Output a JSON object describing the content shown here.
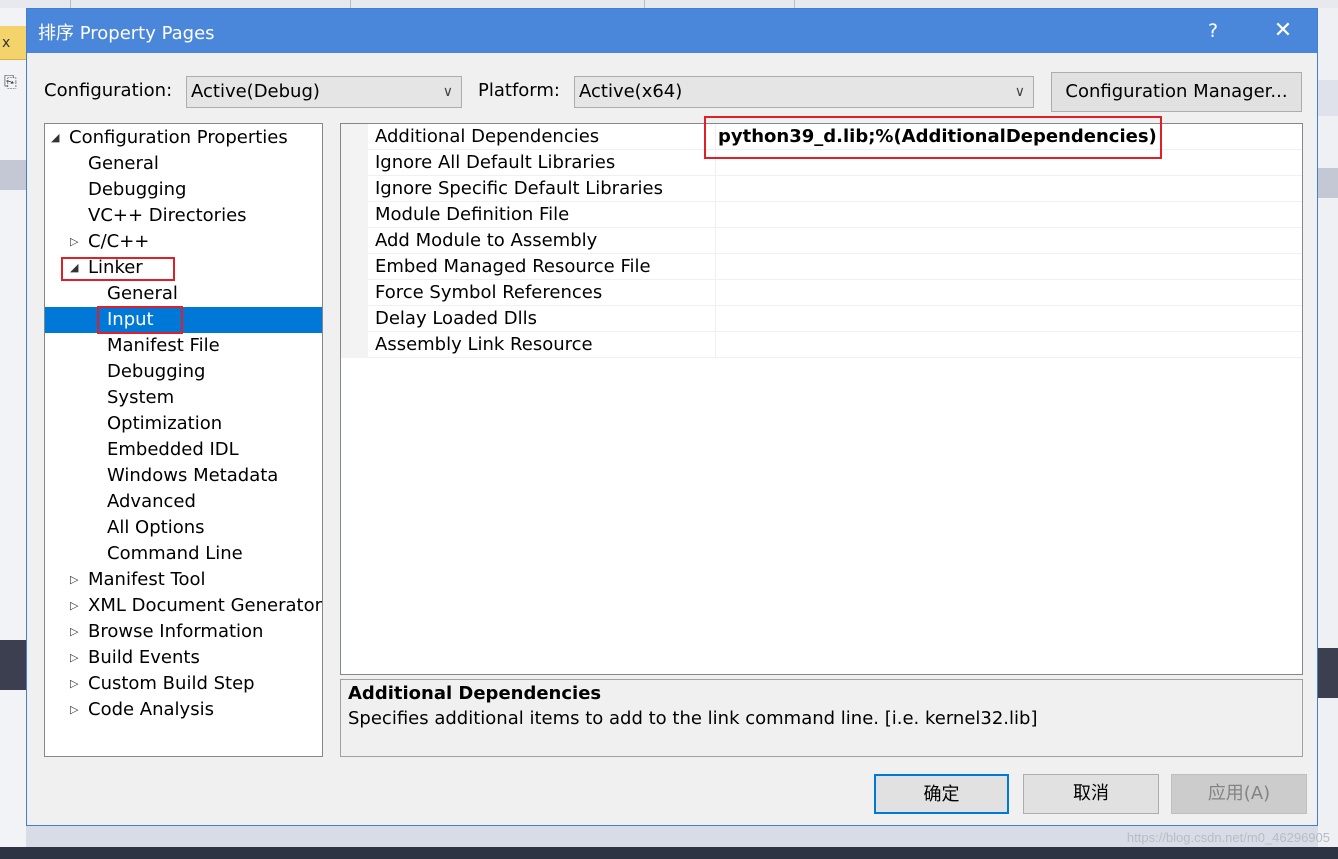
{
  "dialog": {
    "title": "排序 Property Pages",
    "help_glyph": "?",
    "close_glyph": "✕"
  },
  "toolbar": {
    "configuration_label": "Configuration:",
    "configuration_value": "Active(Debug)",
    "platform_label": "Platform:",
    "platform_value": "Active(x64)",
    "config_manager_label": "Configuration Manager..."
  },
  "tree": {
    "items": [
      {
        "label": "Configuration Properties",
        "expanded": true
      },
      {
        "label": "General"
      },
      {
        "label": "Debugging"
      },
      {
        "label": "VC++ Directories"
      },
      {
        "label": "C/C++",
        "expanded": false
      },
      {
        "label": "Linker",
        "expanded": true
      },
      {
        "label": "General"
      },
      {
        "label": "Input",
        "selected": true
      },
      {
        "label": "Manifest File"
      },
      {
        "label": "Debugging"
      },
      {
        "label": "System"
      },
      {
        "label": "Optimization"
      },
      {
        "label": "Embedded IDL"
      },
      {
        "label": "Windows Metadata"
      },
      {
        "label": "Advanced"
      },
      {
        "label": "All Options"
      },
      {
        "label": "Command Line"
      },
      {
        "label": "Manifest Tool",
        "expanded": false
      },
      {
        "label": "XML Document Generator",
        "expanded": false
      },
      {
        "label": "Browse Information",
        "expanded": false
      },
      {
        "label": "Build Events",
        "expanded": false
      },
      {
        "label": "Custom Build Step",
        "expanded": false
      },
      {
        "label": "Code Analysis",
        "expanded": false
      }
    ]
  },
  "properties": {
    "rows": [
      {
        "name": "Additional Dependencies",
        "value": "python39_d.lib;%(AdditionalDependencies)"
      },
      {
        "name": "Ignore All Default Libraries",
        "value": ""
      },
      {
        "name": "Ignore Specific Default Libraries",
        "value": ""
      },
      {
        "name": "Module Definition File",
        "value": ""
      },
      {
        "name": "Add Module to Assembly",
        "value": ""
      },
      {
        "name": "Embed Managed Resource File",
        "value": ""
      },
      {
        "name": "Force Symbol References",
        "value": ""
      },
      {
        "name": "Delay Loaded Dlls",
        "value": ""
      },
      {
        "name": "Assembly Link Resource",
        "value": ""
      }
    ]
  },
  "description": {
    "title": "Additional Dependencies",
    "text": "Specifies additional items to add to the link command line. [i.e. kernel32.lib]"
  },
  "buttons": {
    "ok": "确定",
    "cancel": "取消",
    "apply": "应用(A)"
  },
  "background": {
    "watermark": "https://blog.csdn.net/m0_46296905",
    "tab_glyph": "x",
    "tool_icon": "clipboard-icon"
  },
  "colors": {
    "titlebar": "#4a87db",
    "selection": "#0078d7",
    "highlight_box": "#e01f26"
  }
}
